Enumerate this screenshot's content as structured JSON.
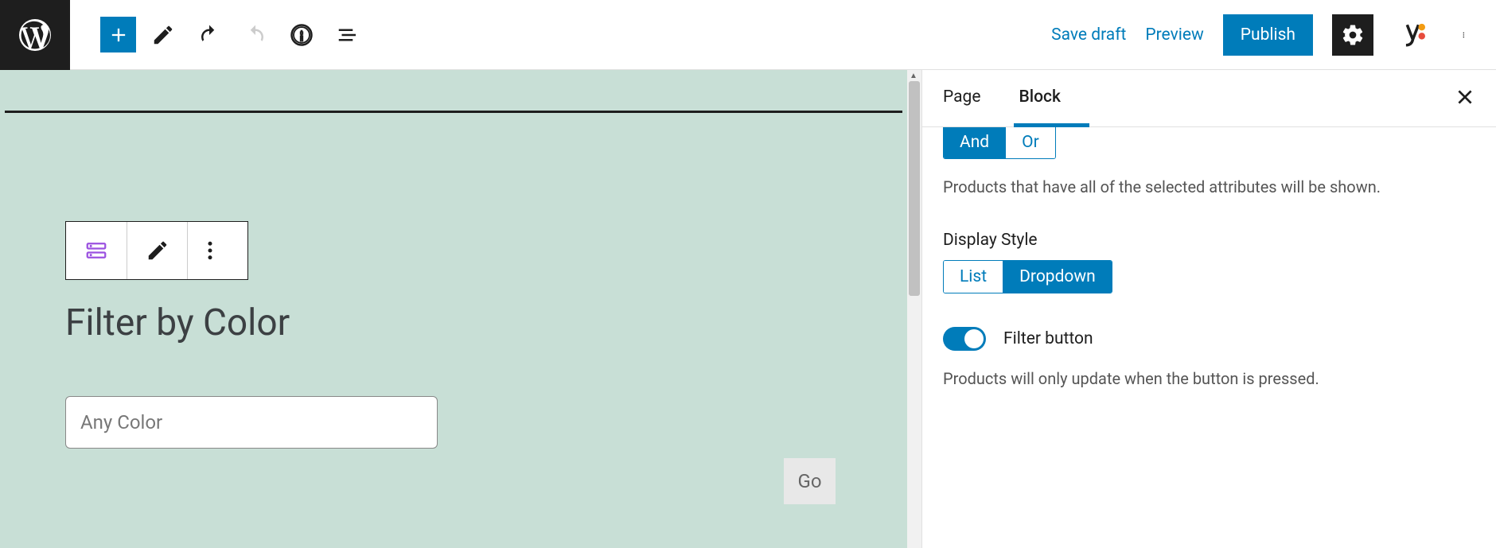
{
  "toolbar": {
    "save_draft": "Save draft",
    "preview": "Preview",
    "publish": "Publish"
  },
  "sidebar": {
    "tabs": {
      "page": "Page",
      "block": "Block"
    },
    "query_type": {
      "options": {
        "and": "And",
        "or": "Or"
      },
      "help": "Products that have all of the selected attributes will be shown."
    },
    "display_style": {
      "label": "Display Style",
      "options": {
        "list": "List",
        "dropdown": "Dropdown"
      }
    },
    "filter_button": {
      "label": "Filter button",
      "help": "Products will only update when the button is pressed."
    }
  },
  "editor": {
    "block_title": "Filter by Color",
    "dropdown_placeholder": "Any Color",
    "go": "Go"
  }
}
